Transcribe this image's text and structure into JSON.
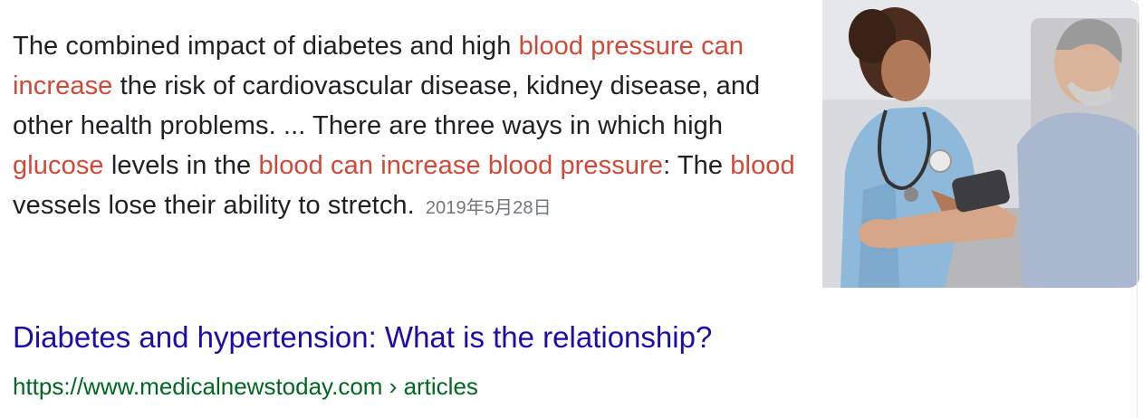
{
  "snippet": {
    "segments": [
      {
        "text": "The combined impact of diabetes and high ",
        "hl": false
      },
      {
        "text": "blood pressure can increase",
        "hl": true
      },
      {
        "text": " the risk of cardiovascular disease, kidney disease, and other health problems. ... There are three ways in which high ",
        "hl": false
      },
      {
        "text": "glucose",
        "hl": true
      },
      {
        "text": " levels in the ",
        "hl": false
      },
      {
        "text": "blood can increase blood pressure",
        "hl": true
      },
      {
        "text": ": The ",
        "hl": false
      },
      {
        "text": "blood",
        "hl": true
      },
      {
        "text": " vessels lose their ability to stretch.",
        "hl": false
      }
    ],
    "date": "2019年5月28日"
  },
  "result": {
    "title": "Diabetes and hypertension: What is the relationship?",
    "url": "https://www.medicalnewstoday.com › articles"
  },
  "colors": {
    "highlight": "#d14836",
    "link": "#1a0dab",
    "url": "#006621",
    "text": "#202124",
    "date": "#70757a"
  },
  "image": {
    "icon": "nurse-measuring-blood-pressure-photo"
  }
}
